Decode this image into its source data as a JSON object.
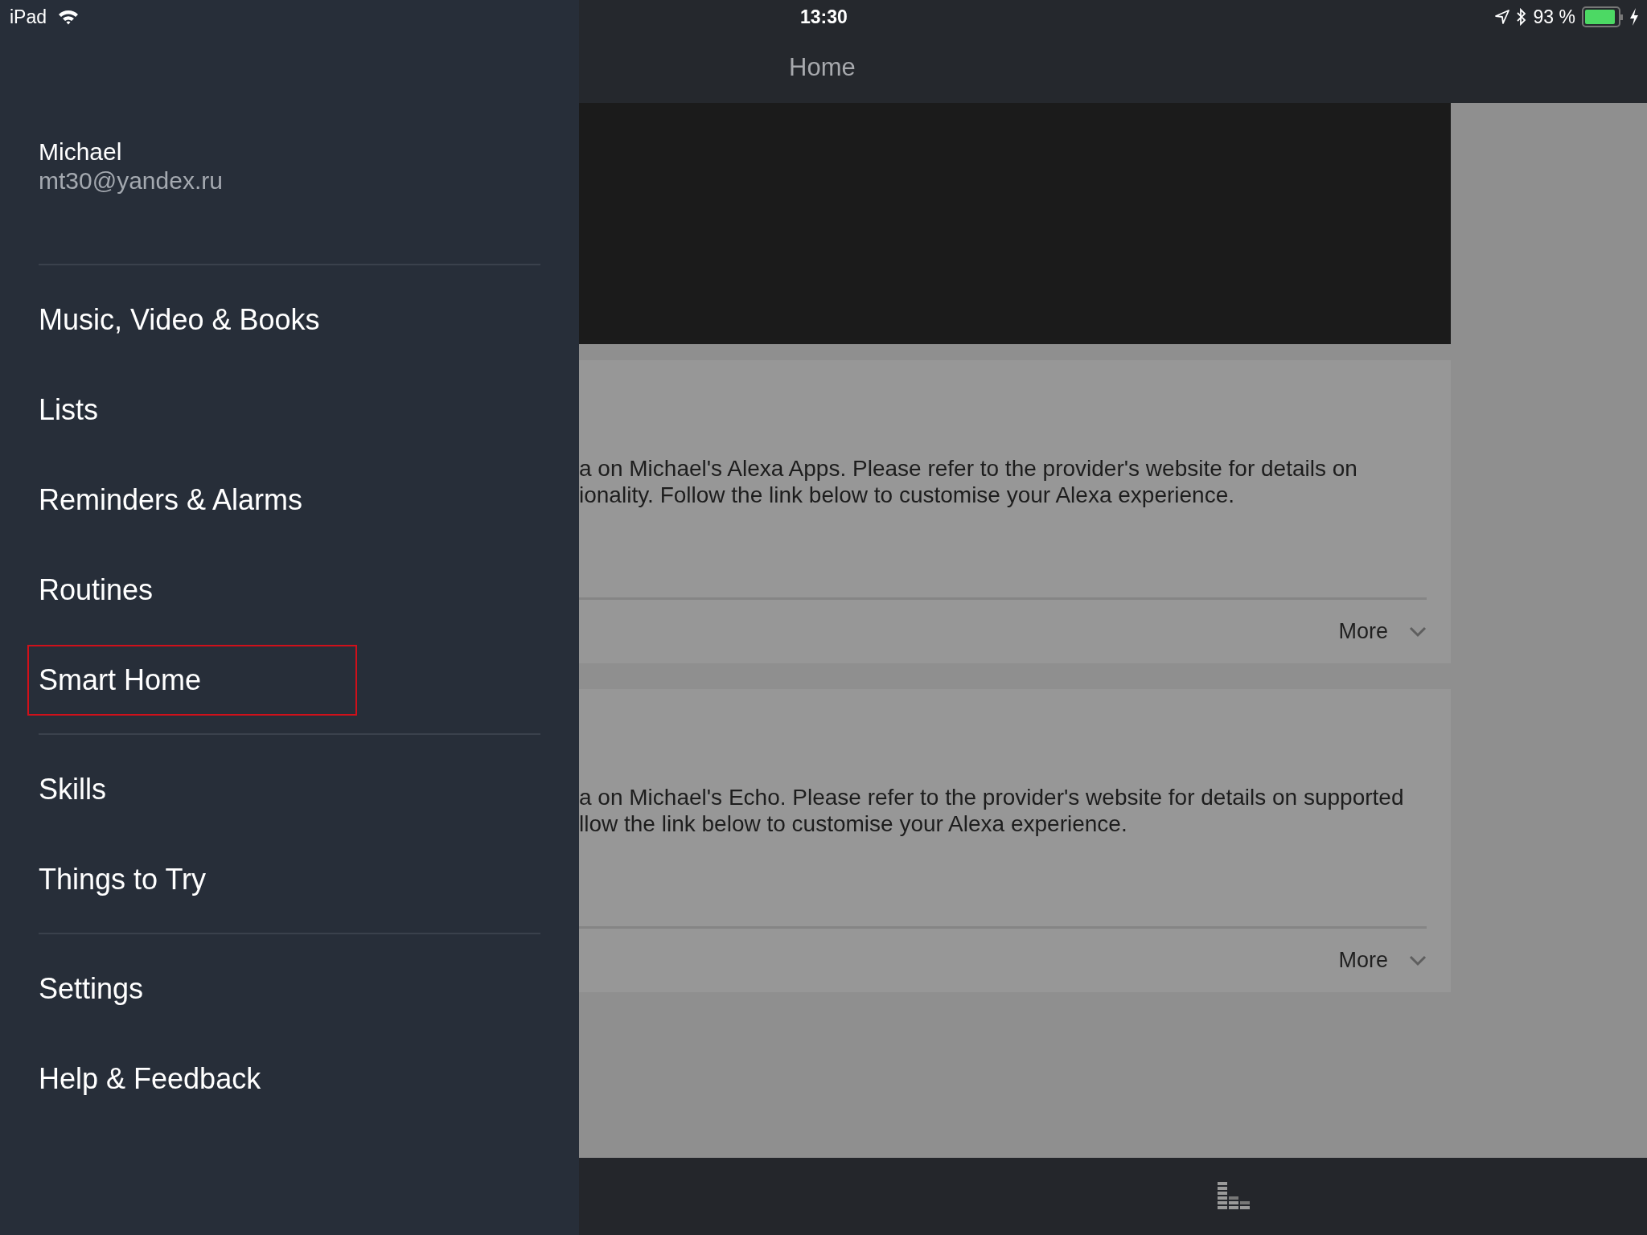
{
  "status_bar": {
    "device": "iPad",
    "time": "13:30",
    "battery_percent": "93 %",
    "battery": {
      "level": 0.93
    }
  },
  "header": {
    "title": "Home"
  },
  "drawer": {
    "user_name": "Michael",
    "user_email": "mt30@yandex.ru",
    "sections": [
      {
        "items": [
          {
            "label": "Music, Video & Books",
            "highlighted": false
          },
          {
            "label": "Lists",
            "highlighted": false
          },
          {
            "label": "Reminders & Alarms",
            "highlighted": false
          },
          {
            "label": "Routines",
            "highlighted": false
          },
          {
            "label": "Smart Home",
            "highlighted": true
          }
        ]
      },
      {
        "items": [
          {
            "label": "Skills",
            "highlighted": false
          },
          {
            "label": "Things to Try",
            "highlighted": false
          }
        ]
      },
      {
        "items": [
          {
            "label": "Settings",
            "highlighted": false
          },
          {
            "label": "Help & Feedback",
            "highlighted": false
          }
        ]
      }
    ]
  },
  "cards": [
    {
      "lines": [
        "a on Michael's Alexa Apps. Please refer to the provider's website for details on",
        "ionality. Follow the link below to customise your Alexa experience."
      ],
      "more": "More"
    },
    {
      "lines": [
        "a on Michael's Echo. Please refer to the provider's website for details on supported",
        "llow the link below to customise your Alexa experience."
      ],
      "more": "More"
    }
  ]
}
